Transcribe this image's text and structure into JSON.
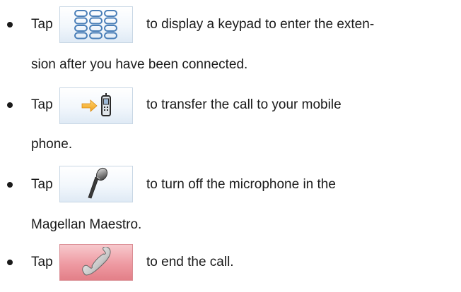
{
  "items": [
    {
      "tap": "Tap",
      "line1": "to display a keypad to enter the exten-",
      "line2": "sion after you have been connected.",
      "icon": "keypad-icon"
    },
    {
      "tap": "Tap",
      "line1": "to transfer the call to your mobile",
      "line2": "phone.",
      "icon": "transfer-to-mobile-icon"
    },
    {
      "tap": "Tap",
      "line1": "to turn off the microphone in the",
      "line2": "Magellan Maestro.",
      "icon": "microphone-icon"
    },
    {
      "tap": "Tap",
      "line1": "to end the call.",
      "icon": "end-call-icon"
    }
  ]
}
